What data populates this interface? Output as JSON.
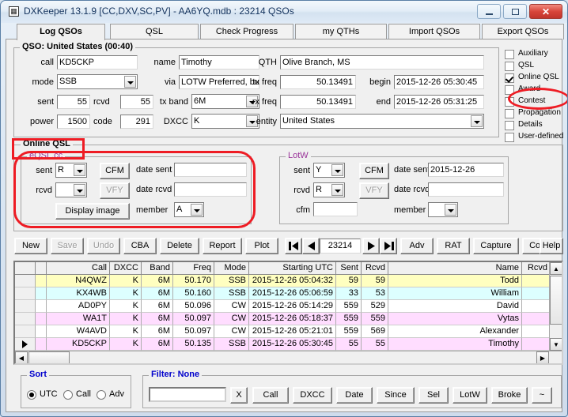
{
  "window": {
    "title": "DXKeeper 13.1.9 [CC,DXV,SC,PV] - AA6YQ.mdb : 23214 QSOs",
    "icon": "logbook-icon",
    "minimize_label": "Minimize",
    "maximize_label": "Maximize",
    "close_label": "✕"
  },
  "tabs": [
    {
      "label": "Log QSOs",
      "selected": true
    },
    {
      "label": "QSL",
      "selected": false
    },
    {
      "label": "Check Progress",
      "selected": false
    },
    {
      "label": "my QTHs",
      "selected": false
    },
    {
      "label": "Import QSOs",
      "selected": false
    },
    {
      "label": "Export QSOs",
      "selected": false
    }
  ],
  "qso": {
    "group_label": "QSO: United States (00:40)",
    "fields": {
      "call_label": "call",
      "call_value": "KD5CKP",
      "name_label": "name",
      "name_value": "Timothy",
      "qth_label": "QTH",
      "qth_value": "Olive Branch, MS",
      "mode_label": "mode",
      "mode_value": "SSB",
      "via_label": "via",
      "via_value": "LOTW Preferred, bu",
      "txfreq_label": "tx freq",
      "txfreq_value": "50.13491",
      "begin_label": "begin",
      "begin_value": "2015-12-26   05:30:45",
      "sent_label": "sent",
      "sent_value": "55",
      "rcvd_label": "rcvd",
      "rcvd_value": "55",
      "txband_label": "tx band",
      "txband_value": "6M",
      "rxfreq_label": "rx freq",
      "rxfreq_value": "50.13491",
      "end_label": "end",
      "end_value": "2015-12-26   05:31:25",
      "power_label": "power",
      "power_value": "1500",
      "code_label": "code",
      "code_value": "291",
      "dxcc_label": "DXCC",
      "dxcc_value": "K",
      "entity_label": "entity",
      "entity_value": "United States"
    }
  },
  "panel_checkboxes": [
    {
      "label": "Auxiliary",
      "checked": false
    },
    {
      "label": "QSL",
      "checked": false
    },
    {
      "label": "Online QSL",
      "checked": true
    },
    {
      "label": "Award",
      "checked": false
    },
    {
      "label": "Contest",
      "checked": false
    },
    {
      "label": "Propagation",
      "checked": false
    },
    {
      "label": "Details",
      "checked": false
    },
    {
      "label": "User-defined",
      "checked": false
    }
  ],
  "online_qsl": {
    "group_label": "Online QSL",
    "eqsl": {
      "group_label": "eQSL.cc",
      "sent_label": "sent",
      "sent_value": "R",
      "rcvd_label": "rcvd",
      "rcvd_value": "",
      "cfm_label": "CFM",
      "vfy_label": "VFY",
      "date_sent_label": "date sent",
      "date_sent_value": "",
      "date_rcvd_label": "date rcvd",
      "date_rcvd_value": "",
      "display_image_label": "Display image",
      "member_label": "member",
      "member_value": "A"
    },
    "lotw": {
      "group_label": "LotW",
      "sent_label": "sent",
      "sent_value": "Y",
      "rcvd_label": "rcvd",
      "rcvd_value": "R",
      "cfm_button_label": "CFM",
      "vfy_button_label": "VFY",
      "date_sent_label": "date sent",
      "date_sent_value": "2015-12-26",
      "date_rcvd_label": "date rcvd",
      "date_rcvd_value": "",
      "cfm_label": "cfm",
      "cfm_value": "",
      "member_label": "member",
      "member_value": ""
    }
  },
  "toolbar": {
    "new_label": "New",
    "save_label": "Save",
    "undo_label": "Undo",
    "cba_label": "CBA",
    "delete_label": "Delete",
    "report_label": "Report",
    "plot_label": "Plot",
    "first_label": "◀▌",
    "prev_label": "◀",
    "record_value": "23214",
    "next_label": "▶",
    "last_label": "▌▶",
    "adv_label": "Adv",
    "rat_label": "RAT",
    "capture_label": "Capture",
    "config_label": "Config",
    "help_label": "Help"
  },
  "grid": {
    "columns": [
      {
        "key": "marker",
        "label": "",
        "width": 26,
        "align": "left"
      },
      {
        "key": "sp",
        "label": "",
        "width": 14,
        "align": "left"
      },
      {
        "key": "call",
        "label": "Call",
        "width": 80,
        "align": "right"
      },
      {
        "key": "dxcc",
        "label": "DXCC",
        "width": 40,
        "align": "right"
      },
      {
        "key": "band",
        "label": "Band",
        "width": 40,
        "align": "right"
      },
      {
        "key": "freq",
        "label": "Freq",
        "width": 52,
        "align": "right"
      },
      {
        "key": "mode",
        "label": "Mode",
        "width": 44,
        "align": "right"
      },
      {
        "key": "utc",
        "label": "Starting UTC",
        "width": 110,
        "align": "right"
      },
      {
        "key": "sent",
        "label": "Sent",
        "width": 32,
        "align": "right"
      },
      {
        "key": "rcvd",
        "label": "Rcvd",
        "width": 34,
        "align": "right"
      },
      {
        "key": "name",
        "label": "Name",
        "width": 185,
        "align": "right"
      },
      {
        "key": "rcvd2",
        "label": "Rcvd",
        "width": 36,
        "align": "right"
      }
    ],
    "rows": [
      {
        "selected": false,
        "color": "#ffffc0",
        "call": "N4QWZ",
        "dxcc": "K",
        "band": "6M",
        "freq": "50.170",
        "mode": "SSB",
        "utc": "2015-12-26   05:04:32",
        "sent": "59",
        "rcvd": "59",
        "name": "Todd",
        "rcvd2": ""
      },
      {
        "selected": false,
        "color": "#ddffff",
        "call": "KX4WB",
        "dxcc": "K",
        "band": "6M",
        "freq": "50.160",
        "mode": "SSB",
        "utc": "2015-12-26   05:06:59",
        "sent": "33",
        "rcvd": "53",
        "name": "William",
        "rcvd2": ""
      },
      {
        "selected": false,
        "color": "#ffffff",
        "call": "AD0PY",
        "dxcc": "K",
        "band": "6M",
        "freq": "50.096",
        "mode": "CW",
        "utc": "2015-12-26   05:14:29",
        "sent": "559",
        "rcvd": "529",
        "name": "David",
        "rcvd2": ""
      },
      {
        "selected": false,
        "color": "#ffddff",
        "call": "WA1T",
        "dxcc": "K",
        "band": "6M",
        "freq": "50.097",
        "mode": "CW",
        "utc": "2015-12-26   05:18:37",
        "sent": "559",
        "rcvd": "559",
        "name": "Vytas",
        "rcvd2": ""
      },
      {
        "selected": false,
        "color": "#ffffff",
        "call": "W4AVD",
        "dxcc": "K",
        "band": "6M",
        "freq": "50.097",
        "mode": "CW",
        "utc": "2015-12-26   05:21:01",
        "sent": "559",
        "rcvd": "569",
        "name": "Alexander",
        "rcvd2": ""
      },
      {
        "selected": true,
        "color": "#ffddff",
        "call": "KD5CKP",
        "dxcc": "K",
        "band": "6M",
        "freq": "50.135",
        "mode": "SSB",
        "utc": "2015-12-26   05:30:45",
        "sent": "55",
        "rcvd": "55",
        "name": "Timothy",
        "rcvd2": ""
      }
    ],
    "scroll_up_icon": "▲",
    "scroll_down_icon": "▼",
    "scroll_left_icon": "◀",
    "scroll_right_icon": "▶"
  },
  "sort": {
    "group_label": "Sort",
    "options": [
      {
        "label": "UTC",
        "selected": true
      },
      {
        "label": "Call",
        "selected": false
      },
      {
        "label": "Adv",
        "selected": false
      }
    ]
  },
  "filter": {
    "group_label": "Filter: None",
    "input_value": "",
    "clear_label": "X",
    "buttons": [
      "Call",
      "DXCC",
      "Date",
      "Since",
      "Sel",
      "LotW",
      "Broke",
      "~"
    ]
  },
  "colors": {
    "annotation": "#ee1c24",
    "group_label_purple": "#993399",
    "filter_label_blue": "#0000cc"
  }
}
